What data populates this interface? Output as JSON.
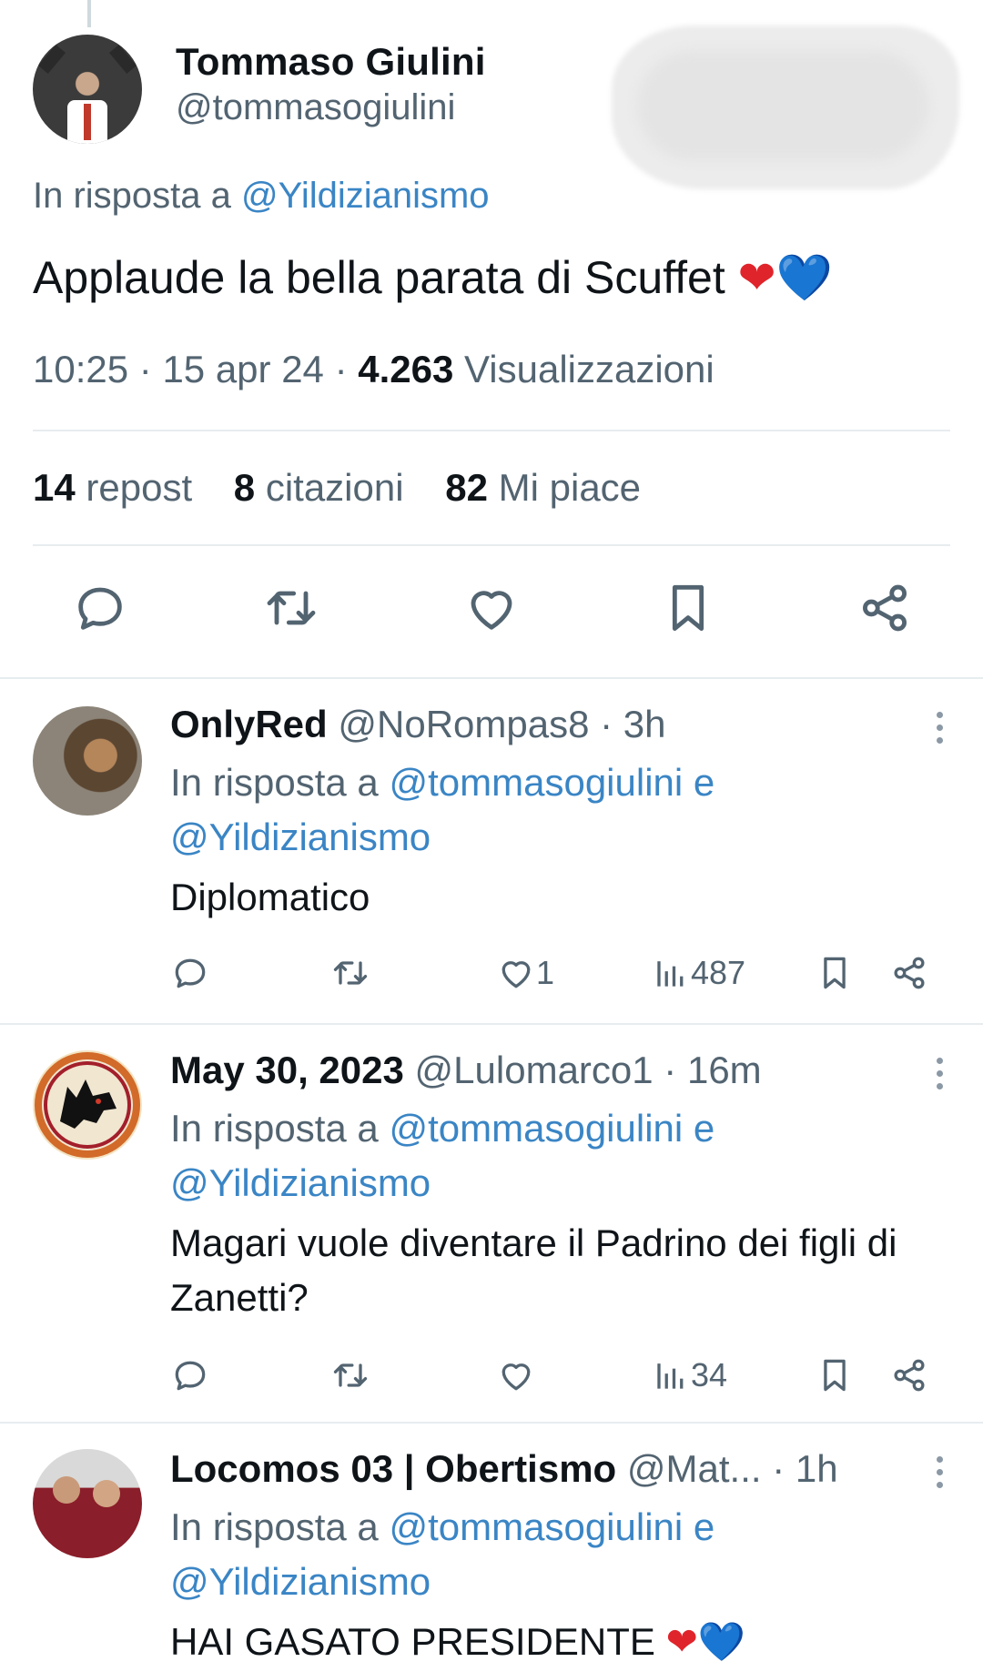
{
  "main_tweet": {
    "author_name": "Tommaso Giulini",
    "author_handle": "@tommasogiulini",
    "reply_prefix": "In risposta a ",
    "reply_to": "@Yildizianismo",
    "text": "Applaude la bella parata di Scuffet ",
    "emoji_red_heart": "❤",
    "emoji_blue_heart": "💙",
    "time": "10:25",
    "date": "15 apr 24",
    "views_count": "4.263",
    "views_label": "Visualizzazioni",
    "reposts_count": "14",
    "reposts_label": "repost",
    "quotes_count": "8",
    "quotes_label": "citazioni",
    "likes_count": "82",
    "likes_label": "Mi piace",
    "actions": [
      "reply-icon",
      "repost-icon",
      "like-icon",
      "bookmark-icon",
      "share-icon"
    ]
  },
  "replies": [
    {
      "name": "OnlyRed",
      "handle": "@NoRompas8",
      "time": "3h",
      "reply_prefix": "In risposta a ",
      "reply_to_1": "@tommasogiulini",
      "reply_join": " e",
      "reply_to_2": "@Yildizianismo",
      "text": "Diplomatico",
      "likes": "1",
      "views": "487"
    },
    {
      "name": "May 30, 2023",
      "handle": "@Lulomarco1",
      "time": "16m",
      "reply_prefix": "In risposta a ",
      "reply_to_1": "@tommasogiulini",
      "reply_join": " e",
      "reply_to_2": "@Yildizianismo",
      "text": "Magari vuole diventare il Padrino dei figli di Zanetti?",
      "likes": "",
      "views": "34"
    },
    {
      "name": "Locomos 03 | Obertismo",
      "handle": "@Mat...",
      "time": "1h",
      "reply_prefix": "In risposta a ",
      "reply_to_1": "@tommasogiulini",
      "reply_join": " e",
      "reply_to_2": "@Yildizianismo",
      "text": "HAI GASATO PRESIDENTE ",
      "emoji_red_heart": "❤",
      "emoji_blue_heart": "💙"
    }
  ],
  "separator": " · ",
  "colors": {
    "text_primary": "#0f1419",
    "text_secondary": "#536471",
    "link": "#3a85c5",
    "divider": "#e7ecef",
    "heart_red": "#e0242b",
    "heart_blue": "#1e6fd9"
  }
}
